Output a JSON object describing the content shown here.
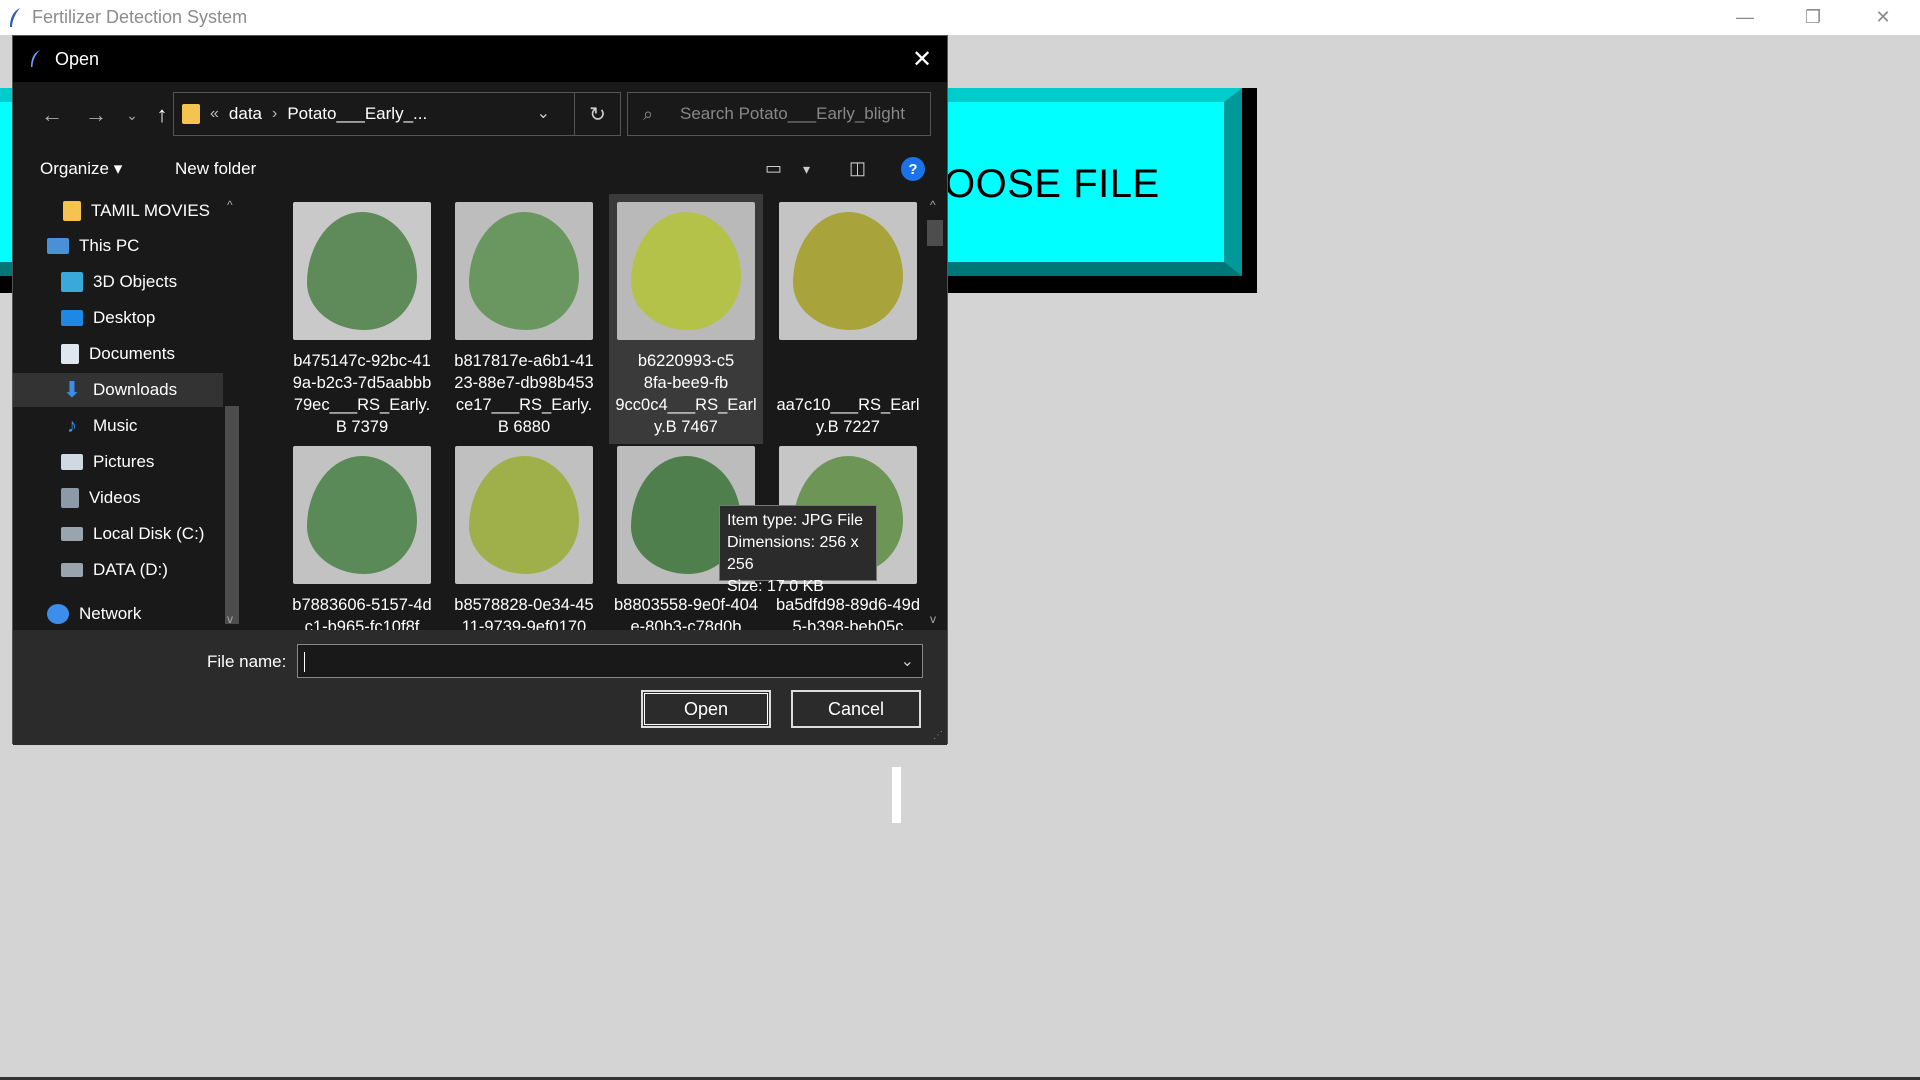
{
  "app": {
    "title": "Fertilizer Detection System",
    "choose_label": "OOSE FILE",
    "accent_color": "#00ffff"
  },
  "window_controls": {
    "minimize": "—",
    "restore": "❐",
    "close": "✕"
  },
  "dialog": {
    "title": "Open",
    "close": "✕",
    "nav": {
      "back": "←",
      "forward": "→",
      "recent": "⌄",
      "up": "↑"
    },
    "address": {
      "overflow": "«",
      "parent": "data",
      "separator": "›",
      "current": "Potato___Early_...",
      "dropdown": "⌄",
      "refresh": "↻"
    },
    "search_placeholder": "Search Potato___Early_blight",
    "toolbar": {
      "organize": "Organize ▾",
      "new_folder": "New folder",
      "view_icon": "▭",
      "view_dropdown": "▾",
      "preview_icon": "◫",
      "help": "?"
    },
    "nav_pane": [
      {
        "label": "TAMIL MOVIES",
        "icon": "folder-icon"
      },
      {
        "label": "This PC",
        "icon": "pc-icon"
      },
      {
        "label": "3D Objects",
        "icon": "cube-icon"
      },
      {
        "label": "Desktop",
        "icon": "desktop-icon"
      },
      {
        "label": "Documents",
        "icon": "documents-icon"
      },
      {
        "label": "Downloads",
        "icon": "downloads-icon"
      },
      {
        "label": "Music",
        "icon": "music-icon"
      },
      {
        "label": "Pictures",
        "icon": "pictures-icon"
      },
      {
        "label": "Videos",
        "icon": "videos-icon"
      },
      {
        "label": "Local Disk (C:)",
        "icon": "disk-icon"
      },
      {
        "label": "DATA (D:)",
        "icon": "disk-icon"
      },
      {
        "label": "Network",
        "icon": "network-icon"
      }
    ],
    "files": [
      {
        "name": "b475147c-92bc-419a-b2c3-7d5aabbb79ec___RS_Early.B 7379",
        "color": "#5f8a5a"
      },
      {
        "name": "b817817e-a6b1-4123-88e7-db98b453ce17___RS_Early.B 6880",
        "color": "#6a9660"
      },
      {
        "name": "b6220993-c5",
        "name_line2": "8fa-bee9-fb",
        "name_line3": "9cc0c4___RS_Earl",
        "name_line4": "y.B 7467",
        "color": "#b5c24a"
      },
      {
        "name_line3": "aa7c10___RS_Earl",
        "name_line4": "y.B 7227",
        "color": "#a8a33a"
      },
      {
        "name": "b7883606-5157-4dc1-b965-fc10f8f",
        "color": "#5a8a58"
      },
      {
        "name": "b8578828-0e34-4511-9739-9ef0170",
        "color": "#9fb04a"
      },
      {
        "name": "b8803558-9e0f-404e-80b3-c78d0b",
        "color": "#4f7f4c"
      },
      {
        "name": "ba5dfd98-89d6-49d5-b398-beb05c",
        "color": "#6d9555"
      }
    ],
    "tooltip": {
      "type": "Item type: JPG File",
      "dimensions": "Dimensions: 256 x 256",
      "size": "Size: 17.0 KB"
    },
    "file_name_label": "File name:",
    "file_name_value": "",
    "open_button": "Open",
    "cancel_button": "Cancel"
  }
}
